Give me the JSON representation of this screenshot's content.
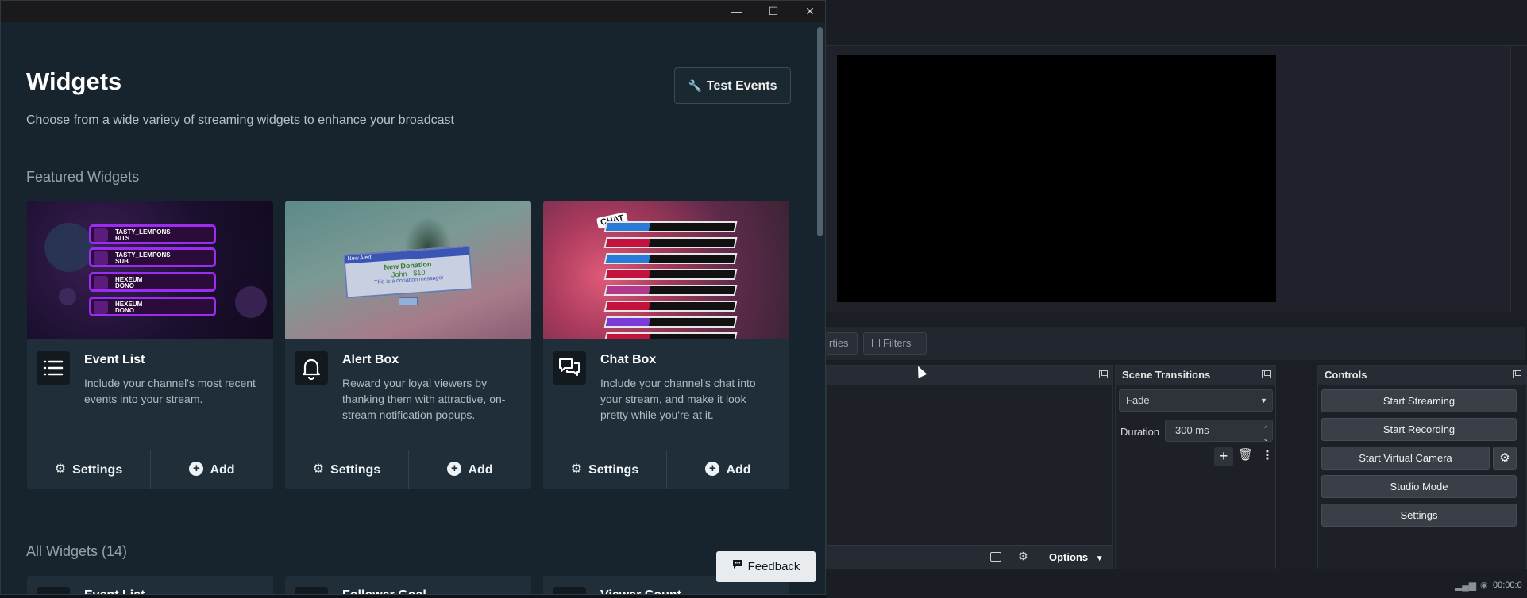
{
  "window": {
    "minimize": "—",
    "maximize": "☐",
    "close": "✕"
  },
  "header": {
    "title": "Widgets",
    "subtitle": "Choose from a wide variety of streaming widgets to enhance your broadcast",
    "test_events_label": "Test Events"
  },
  "featured": {
    "heading": "Featured Widgets",
    "cards": [
      {
        "title": "Event List",
        "description": "Include your channel's most recent events into your stream.",
        "settings_label": "Settings",
        "add_label": "Add",
        "thumb_rows": [
          {
            "name": "TASTY_LEMPONS",
            "type": "BITS"
          },
          {
            "name": "TASTY_LEMPONS",
            "type": "SUB"
          },
          {
            "name": "HEXEUM",
            "type": "DONO"
          },
          {
            "name": "HEXEUM",
            "type": "DONO"
          }
        ]
      },
      {
        "title": "Alert Box",
        "description": "Reward your loyal viewers by thanking them with attractive, on-stream notification popups.",
        "settings_label": "Settings",
        "add_label": "Add",
        "thumb_text": {
          "window_title": "New Alert!",
          "headline": "New Donation",
          "amount": "John - $10",
          "message": "This is a donation message!"
        }
      },
      {
        "title": "Chat Box",
        "description": "Include your channel's chat into your stream, and make it look pretty while you're at it.",
        "settings_label": "Settings",
        "add_label": "Add",
        "thumb_badge": "CHAT"
      }
    ]
  },
  "all_widgets": {
    "heading": "All Widgets (14)",
    "cards": [
      {
        "title": "Event List"
      },
      {
        "title": "Follower Goal"
      },
      {
        "title": "Viewer Count"
      }
    ]
  },
  "feedback_label": "Feedback",
  "obs": {
    "tabs": {
      "properties": "rties",
      "filters": "Filters"
    },
    "sources_dock": {
      "options_label": "Options"
    },
    "scene_transitions": {
      "title": "Scene Transitions",
      "transition": "Fade",
      "duration_label": "Duration",
      "duration_value": "300 ms"
    },
    "controls": {
      "title": "Controls",
      "start_streaming": "Start Streaming",
      "start_recording": "Start Recording",
      "start_virtual_camera": "Start Virtual Camera",
      "studio_mode": "Studio Mode",
      "settings": "Settings"
    },
    "status": {
      "time": "00:00:0"
    }
  },
  "colors": {
    "window_bg": "#17242d",
    "card_bg": "#1f2e38",
    "obs_bg": "#1b1e25",
    "accent_purple": "#9b2cf0"
  }
}
